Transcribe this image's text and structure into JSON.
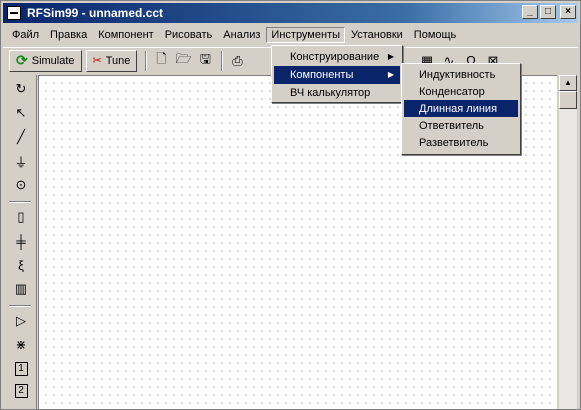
{
  "window": {
    "title": "RFSim99 - unnamed.cct",
    "buttons": [
      "_",
      "□",
      "×"
    ]
  },
  "menubar": [
    "Файл",
    "Правка",
    "Компонент",
    "Рисовать",
    "Анализ",
    "Инструменты",
    "Установки",
    "Помощь"
  ],
  "toolbar": {
    "simulate_label": "Simulate",
    "tune_label": "Tune"
  },
  "instruments_menu": {
    "items": [
      {
        "label": "Конструирование",
        "submenu": true
      },
      {
        "label": "Компоненты",
        "submenu": true,
        "selected": true
      },
      {
        "label": "ВЧ калькулятор",
        "submenu": false
      }
    ]
  },
  "components_submenu": {
    "items": [
      {
        "label": "Индуктивность"
      },
      {
        "label": "Конденсатор"
      },
      {
        "label": "Длинная линия",
        "selected": true
      },
      {
        "label": "Ответвитель"
      },
      {
        "label": "Разветвитель"
      }
    ]
  },
  "left_tools": {
    "box1_label": "1",
    "box2_label": "2"
  },
  "colors": {
    "selection": "#0a246a",
    "titlebar": "#08246b",
    "face": "#d4d0c8"
  }
}
